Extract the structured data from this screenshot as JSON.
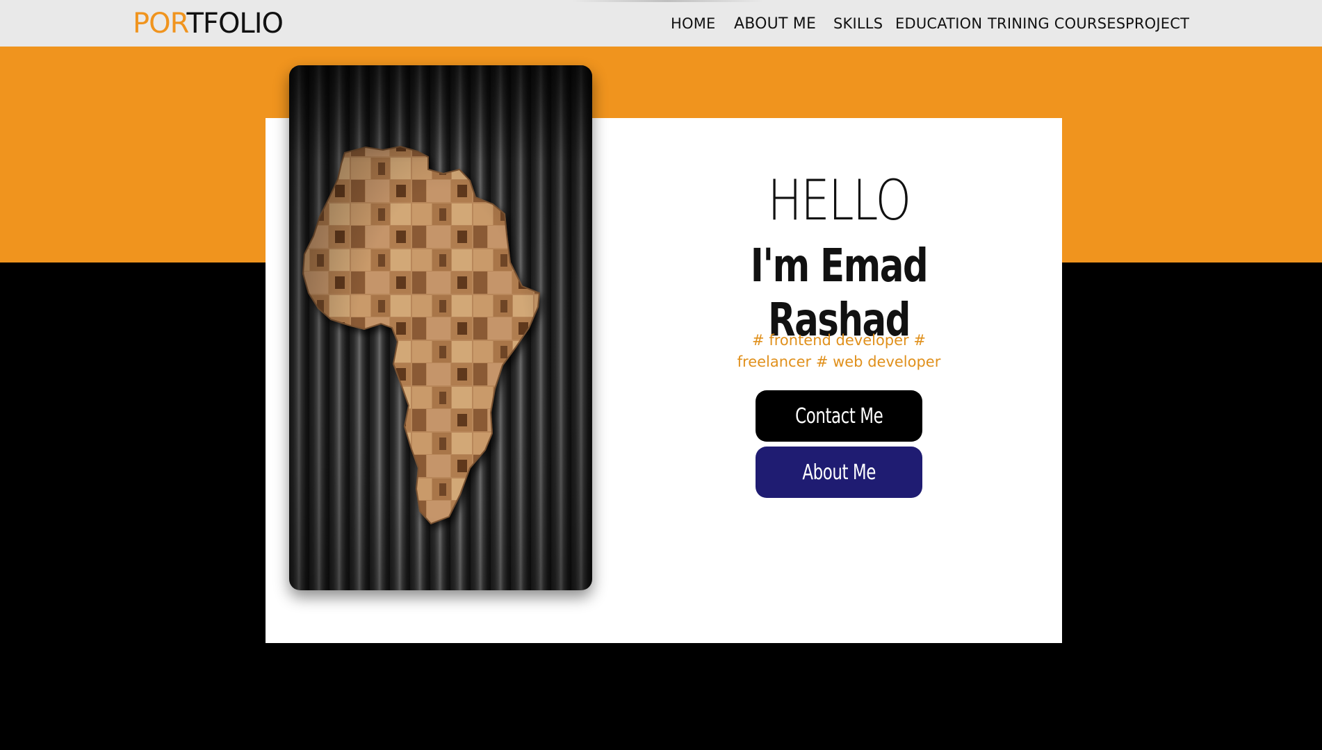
{
  "navbar": {
    "logo_part1": "POR",
    "logo_part2": "TFOLIO",
    "links": [
      {
        "label": "HOME"
      },
      {
        "label": "ABOUT ME"
      },
      {
        "label": "SKILLS"
      },
      {
        "label": "EDUCATION"
      },
      {
        "label": "TRINING COURSES"
      },
      {
        "label": "PROJECT"
      }
    ]
  },
  "hero": {
    "greeting": "HELLO",
    "name": "I'm Emad Rashad",
    "tagline_line1": "# frontend developer #",
    "tagline_line2": "freelancer # web developer",
    "contact_button": "Contact Me",
    "about_button": "About Me",
    "image": "africa-map-wood-on-corrugated-metal"
  },
  "colors": {
    "accent_orange": "#f0941e",
    "navbar_bg": "#e9e9e9",
    "background_black": "#000000",
    "card_white": "#ffffff",
    "button_navy": "#1f1c72"
  }
}
